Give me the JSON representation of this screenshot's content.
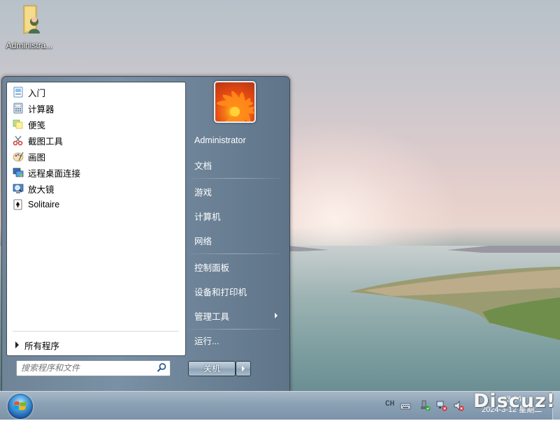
{
  "desktop": {
    "icons": [
      {
        "label": "Administra...",
        "icon": "user-folder-icon"
      }
    ]
  },
  "start_menu": {
    "programs": [
      {
        "label": "入门",
        "icon": "getting-started-icon"
      },
      {
        "label": "计算器",
        "icon": "calculator-icon"
      },
      {
        "label": "便笺",
        "icon": "sticky-notes-icon"
      },
      {
        "label": "截图工具",
        "icon": "snipping-tool-icon"
      },
      {
        "label": "画图",
        "icon": "paint-icon"
      },
      {
        "label": "远程桌面连接",
        "icon": "remote-desktop-icon"
      },
      {
        "label": "放大镜",
        "icon": "magnifier-icon"
      },
      {
        "label": "Solitaire",
        "icon": "solitaire-icon"
      }
    ],
    "all_programs": "所有程序",
    "search_placeholder": "搜索程序和文件",
    "right": {
      "user": "Administrator",
      "documents": "文档",
      "games": "游戏",
      "computer": "计算机",
      "network": "网络",
      "control_panel": "控制面板",
      "devices_printers": "设备和打印机",
      "admin_tools": "管理工具",
      "run": "运行..."
    },
    "shutdown_label": "关机"
  },
  "taskbar": {
    "language": "CH",
    "clock_time": "23:04",
    "clock_date": "2024-3-12 星期二",
    "tray_icons": [
      "keyboard-icon",
      "safely-remove-hardware-icon",
      "network-icon",
      "volume-muted-icon"
    ]
  },
  "watermark": "Discuz!",
  "colors": {
    "taskbar": "#8aa0b4",
    "start_menu_right": "#6f8497",
    "desktop_sky": "#dccbcc"
  }
}
